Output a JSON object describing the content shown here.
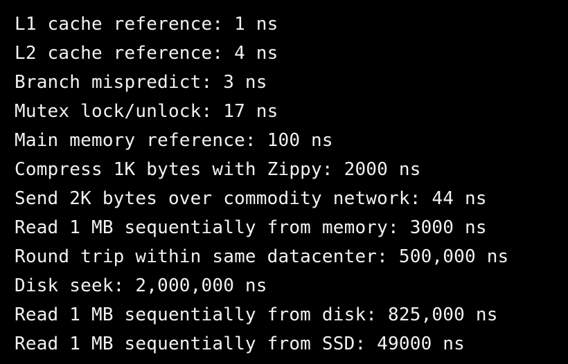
{
  "terminal": {
    "text_color": "#f2f2f2",
    "background_color": "#000000",
    "lines": [
      "L1 cache reference: 1 ns",
      "L2 cache reference: 4 ns",
      "Branch mispredict: 3 ns",
      "Mutex lock/unlock: 17 ns",
      "Main memory reference: 100 ns",
      "Compress 1K bytes with Zippy: 2000 ns",
      "Send 2K bytes over commodity network: 44 ns",
      "Read 1 MB sequentially from memory: 3000 ns",
      "Round trip within same datacenter: 500,000 ns",
      "Disk seek: 2,000,000 ns",
      "Read 1 MB sequentially from disk: 825,000 ns",
      "Read 1 MB sequentially from SSD: 49000 ns"
    ]
  }
}
